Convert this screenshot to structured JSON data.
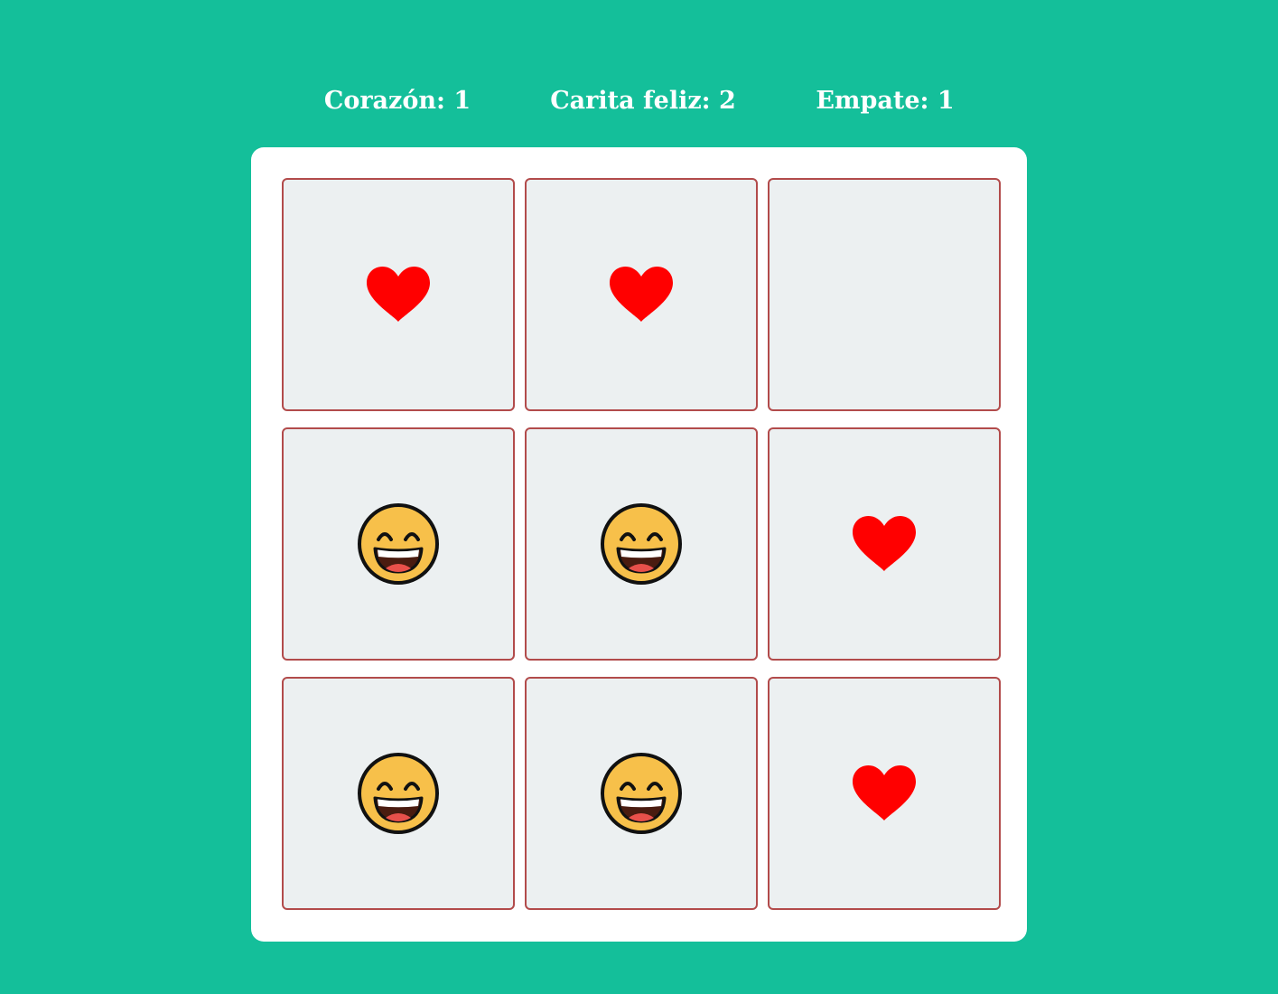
{
  "scoreboard": {
    "heart": "Corazón: 1",
    "smiley": "Carita feliz: 2",
    "tie": "Empate: 1"
  },
  "board": {
    "cells": [
      "heart-icon",
      "heart-icon",
      "",
      "smiley-icon",
      "smiley-icon",
      "heart-icon",
      "smiley-icon",
      "smiley-icon",
      "heart-icon"
    ]
  },
  "colors": {
    "background": "#14bf9a",
    "board": "#ffffff",
    "cell": "#ecf0f1",
    "cell_border": "#b24b4b",
    "heart": "#ff0000",
    "smiley": "#f7c04a"
  }
}
